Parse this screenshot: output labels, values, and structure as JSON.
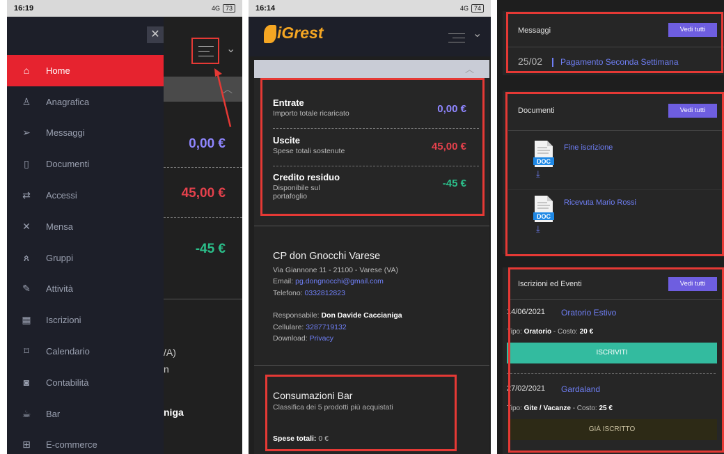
{
  "panel1": {
    "status": {
      "time": "16:19",
      "signal": "4G",
      "battery": "73"
    },
    "close_icon": "✕",
    "menu": [
      {
        "icon": "home-icon",
        "glyph": "⌂",
        "label": "Home",
        "active": true
      },
      {
        "icon": "user-icon",
        "glyph": "♙",
        "label": "Anagrafica",
        "active": false
      },
      {
        "icon": "send-icon",
        "glyph": "➢",
        "label": "Messaggi",
        "active": false
      },
      {
        "icon": "document-icon",
        "glyph": "▯",
        "label": "Documenti",
        "active": false
      },
      {
        "icon": "swap-icon",
        "glyph": "⇄",
        "label": "Accessi",
        "active": false
      },
      {
        "icon": "cutlery-icon",
        "glyph": "✕",
        "label": "Mensa",
        "active": false
      },
      {
        "icon": "group-icon",
        "glyph": "ጰ",
        "label": "Gruppi",
        "active": false
      },
      {
        "icon": "edit-icon",
        "glyph": "✎",
        "label": "Attività",
        "active": false
      },
      {
        "icon": "calendar-grid-icon",
        "glyph": "▦",
        "label": "Iscrizioni",
        "active": false
      },
      {
        "icon": "bookmark-icon",
        "glyph": "⌑",
        "label": "Calendario",
        "active": false
      },
      {
        "icon": "money-icon",
        "glyph": "◙",
        "label": "Contabilità",
        "active": false
      },
      {
        "icon": "cup-icon",
        "glyph": "☕",
        "label": "Bar",
        "active": false
      },
      {
        "icon": "gift-icon",
        "glyph": "⊞",
        "label": "E-commerce",
        "active": false
      }
    ],
    "behind": {
      "entrate_value": "0,00 €",
      "uscite_value": "45,00 €",
      "credito_value": "-45 €",
      "text_va": "/A)",
      "text_n": "n",
      "text_niga": "niga"
    }
  },
  "panel2": {
    "status": {
      "time": "16:14",
      "signal": "4G",
      "battery": "74"
    },
    "logo": "iGrest",
    "summary": [
      {
        "title": "Entrate",
        "subtitle": "Importo totale ricaricato",
        "value": "0,00 €",
        "color": "#8f86ff"
      },
      {
        "title": "Uscite",
        "subtitle": "Spese totali sostenute",
        "value": "45,00 €",
        "color": "#e5414c"
      },
      {
        "title": "Credito residuo",
        "subtitle": "Disponibile sul portafoglio",
        "value": "-45 €",
        "color": "#2bbf8a"
      }
    ],
    "info": {
      "title": "CP don Gnocchi Varese",
      "address": "Via Giannone 11 - 21100 - Varese (VA)",
      "email_label": "Email:",
      "email": "pg.dongnocchi@gmail.com",
      "phone_label": "Telefono:",
      "phone": "0332812823",
      "resp_label": "Responsabile:",
      "resp": "Don Davide Caccianiga",
      "cell_label": "Cellulare:",
      "cell": "3287719132",
      "download_label": "Download:",
      "download": "Privacy"
    },
    "bar": {
      "title": "Consumazioni Bar",
      "subtitle": "Classifica dei 5 prodotti più acquistati",
      "total_label": "Spese totali:",
      "total": "0 €"
    }
  },
  "panel3": {
    "messaggi": {
      "title": "Messaggi",
      "button": "Vedi tutti",
      "date": "25/02",
      "item": "Pagamento Seconda Settimana"
    },
    "documenti": {
      "title": "Documenti",
      "button": "Vedi tutti",
      "doc_label": "DOC",
      "items": [
        "Fine iscrizione",
        "Ricevuta Mario Rossi"
      ]
    },
    "eventi": {
      "title": "Iscrizioni ed Eventi",
      "button": "Vedi tutti",
      "items": [
        {
          "date": "14/06/2021",
          "name": "Oratorio Estivo",
          "tipo_label": "Tipo:",
          "tipo": "Oratorio",
          "costo_label": "- Costo:",
          "costo": "20 €",
          "action": "ISCRIVITI"
        },
        {
          "date": "27/02/2021",
          "name": "Gardaland",
          "tipo_label": "Tipo:",
          "tipo": "Gite / Vacanze",
          "costo_label": "- Costo:",
          "costo": "25 €",
          "action": "GIÀ ISCRITTO"
        }
      ]
    }
  }
}
